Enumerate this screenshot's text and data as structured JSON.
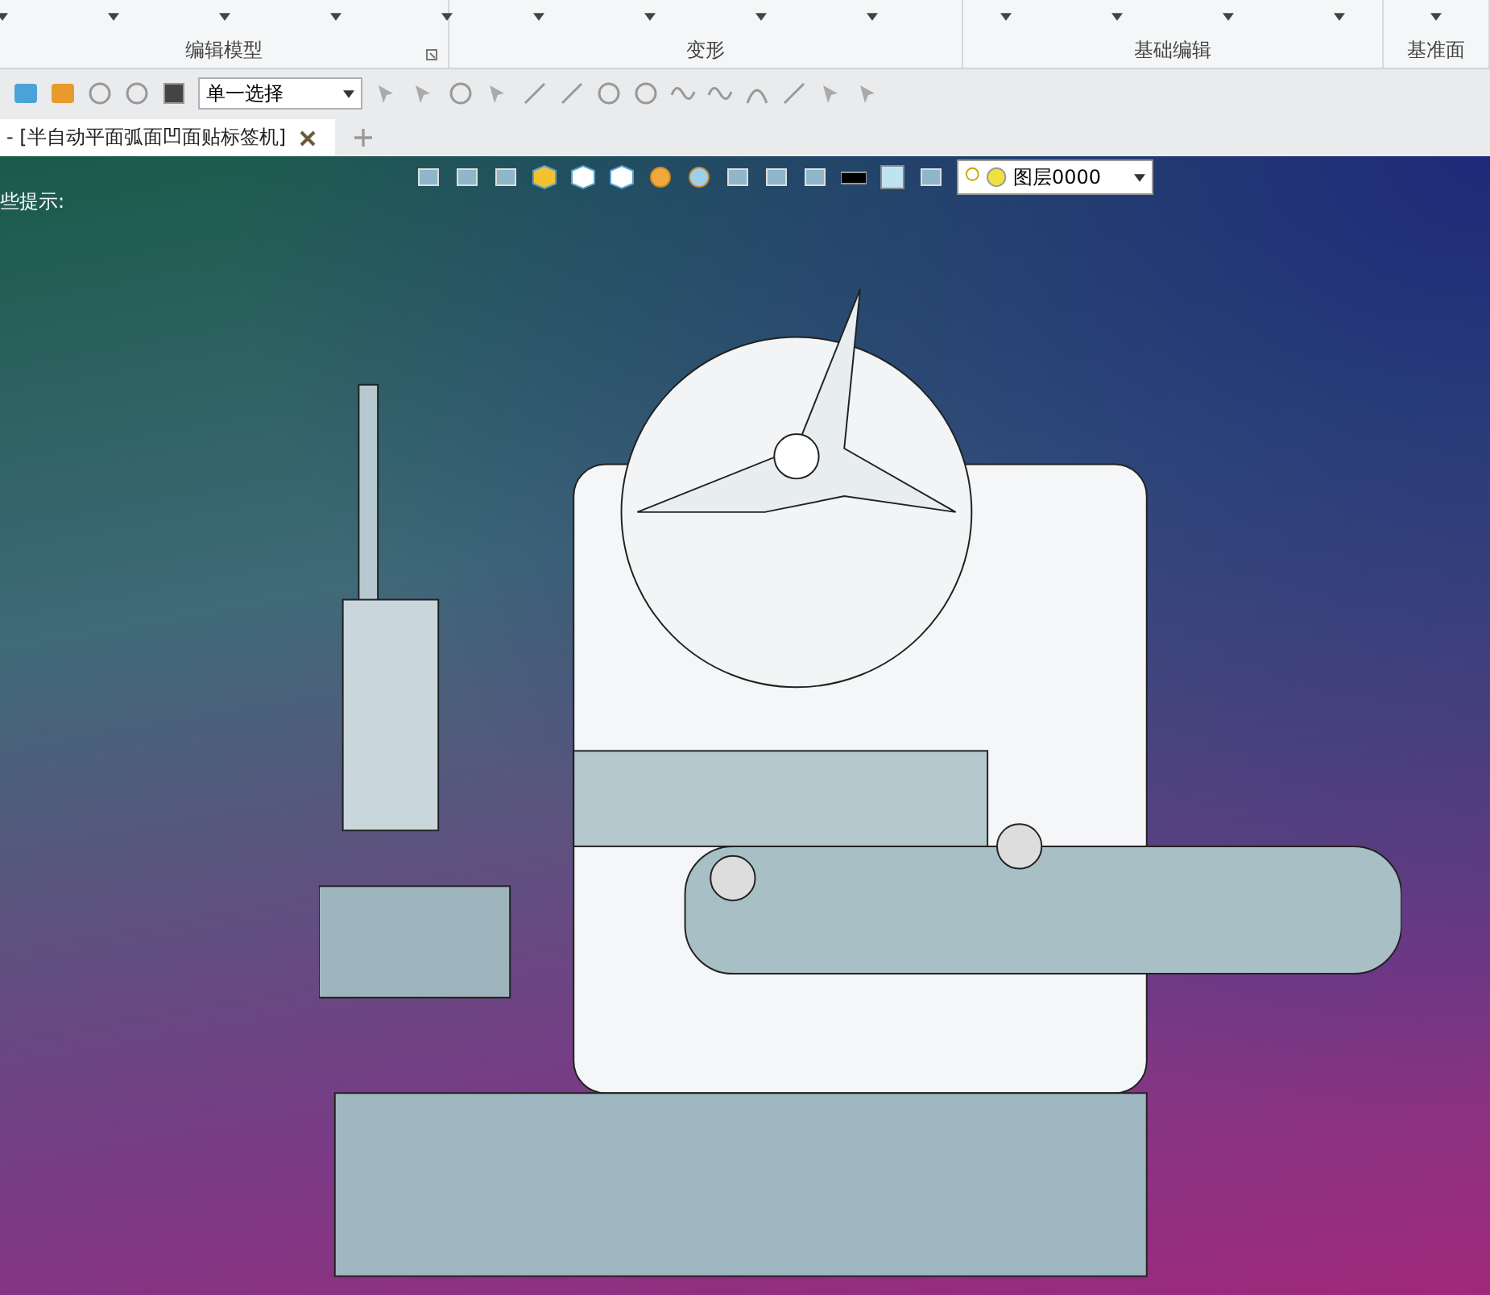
{
  "ribbon": {
    "groups": [
      {
        "label": "编辑模型"
      },
      {
        "label": "变形"
      },
      {
        "label": "基础编辑"
      },
      {
        "label": "基准面"
      }
    ]
  },
  "toolbar": {
    "selection_mode": "单一选择"
  },
  "tabs": [
    {
      "label": "- [半自动平面弧面凹面贴标签机]",
      "selected": true
    }
  ],
  "viewport": {
    "hint": "些提示:",
    "layer": "图层0000"
  }
}
